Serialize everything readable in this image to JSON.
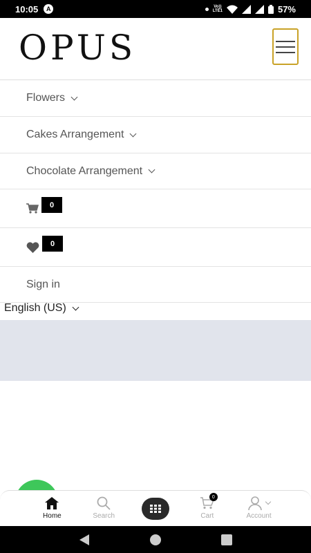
{
  "status_bar": {
    "time": "10:05",
    "battery": "57%",
    "volte_line1": "Vo))",
    "volte_line2": "LTE1"
  },
  "brand": {
    "logo": "OPUS",
    "accent": "#c9a227"
  },
  "menu": {
    "flowers": "Flowers",
    "cakes": "Cakes Arrangement",
    "chocolate": "Chocolate Arrangement",
    "cart_count": "0",
    "wishlist_count": "0",
    "sign_in": "Sign in"
  },
  "language": {
    "selected": "English (US)"
  },
  "bottom_nav": {
    "home": "Home",
    "search": "Search",
    "cart": "Cart",
    "cart_count": "0",
    "account": "Account"
  },
  "icons": [
    "home-icon",
    "search-icon",
    "grid-icon",
    "cart-icon",
    "user-icon",
    "heart-icon",
    "hamburger-icon"
  ]
}
